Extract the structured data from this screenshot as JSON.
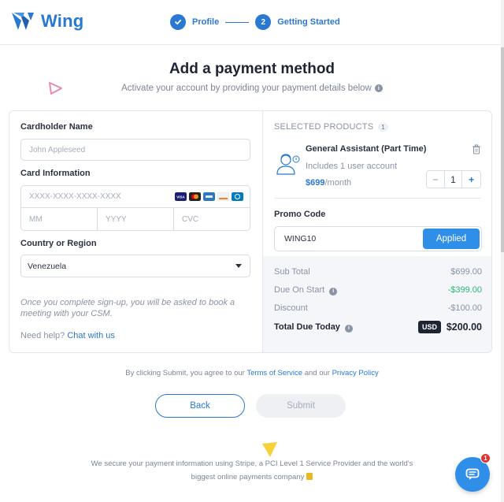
{
  "header": {
    "brand": "Wing",
    "steps": [
      {
        "number": "",
        "label": "Profile",
        "status": "completed"
      },
      {
        "number": "2",
        "label": "Getting Started",
        "status": "active"
      }
    ]
  },
  "page": {
    "title": "Add a payment method",
    "subtitle": "Activate your account by providing your payment details below"
  },
  "form": {
    "cardholder_label": "Cardholder Name",
    "cardholder_placeholder": "John Appleseed",
    "card_info_label": "Card Information",
    "card_number_placeholder": "XXXX-XXXX-XXXX-XXXX",
    "month_placeholder": "MM",
    "year_placeholder": "YYYY",
    "cvc_placeholder": "CVC",
    "country_label": "Country or Region",
    "country_value": "Venezuela",
    "note": "Once you complete sign-up, you will be asked to book a meeting with your CSM.",
    "help_text": "Need help?",
    "help_link": "Chat with us",
    "card_brands": [
      "visa-icon",
      "mastercard-icon",
      "amex-icon",
      "discover-icon",
      "diners-icon"
    ]
  },
  "products": {
    "heading": "SELECTED PRODUCTS",
    "count": "1",
    "items": [
      {
        "name": "General Assistant (Part Time)",
        "description": "Includes 1 user account",
        "price": "$699",
        "period": "/month",
        "quantity": "1"
      }
    ]
  },
  "promo": {
    "label": "Promo Code",
    "value": "WING10",
    "button": "Applied"
  },
  "summary": {
    "subtotal_label": "Sub Total",
    "subtotal": "$699.00",
    "due_on_start_label": "Due On Start",
    "due_on_start": "-$399.00",
    "discount_label": "Discount",
    "discount": "-$100.00",
    "total_label": "Total Due Today",
    "currency": "USD",
    "total": "$200.00"
  },
  "footer": {
    "terms_prefix": "By clicking Submit, you agree to our",
    "terms_link": "Terms of Service",
    "terms_mid": "and our",
    "privacy_link": "Privacy Policy",
    "back_button": "Back",
    "submit_button": "Submit",
    "secure_text": "We secure your payment information using Stripe, a PCI Level 1 Service Provider and the world's biggest online payments company",
    "chat_badge": "1"
  },
  "colors": {
    "accent": "#2a78d2",
    "button_blue": "#2f8ee8",
    "success": "#2bb673",
    "text_dark": "#1e2433"
  }
}
